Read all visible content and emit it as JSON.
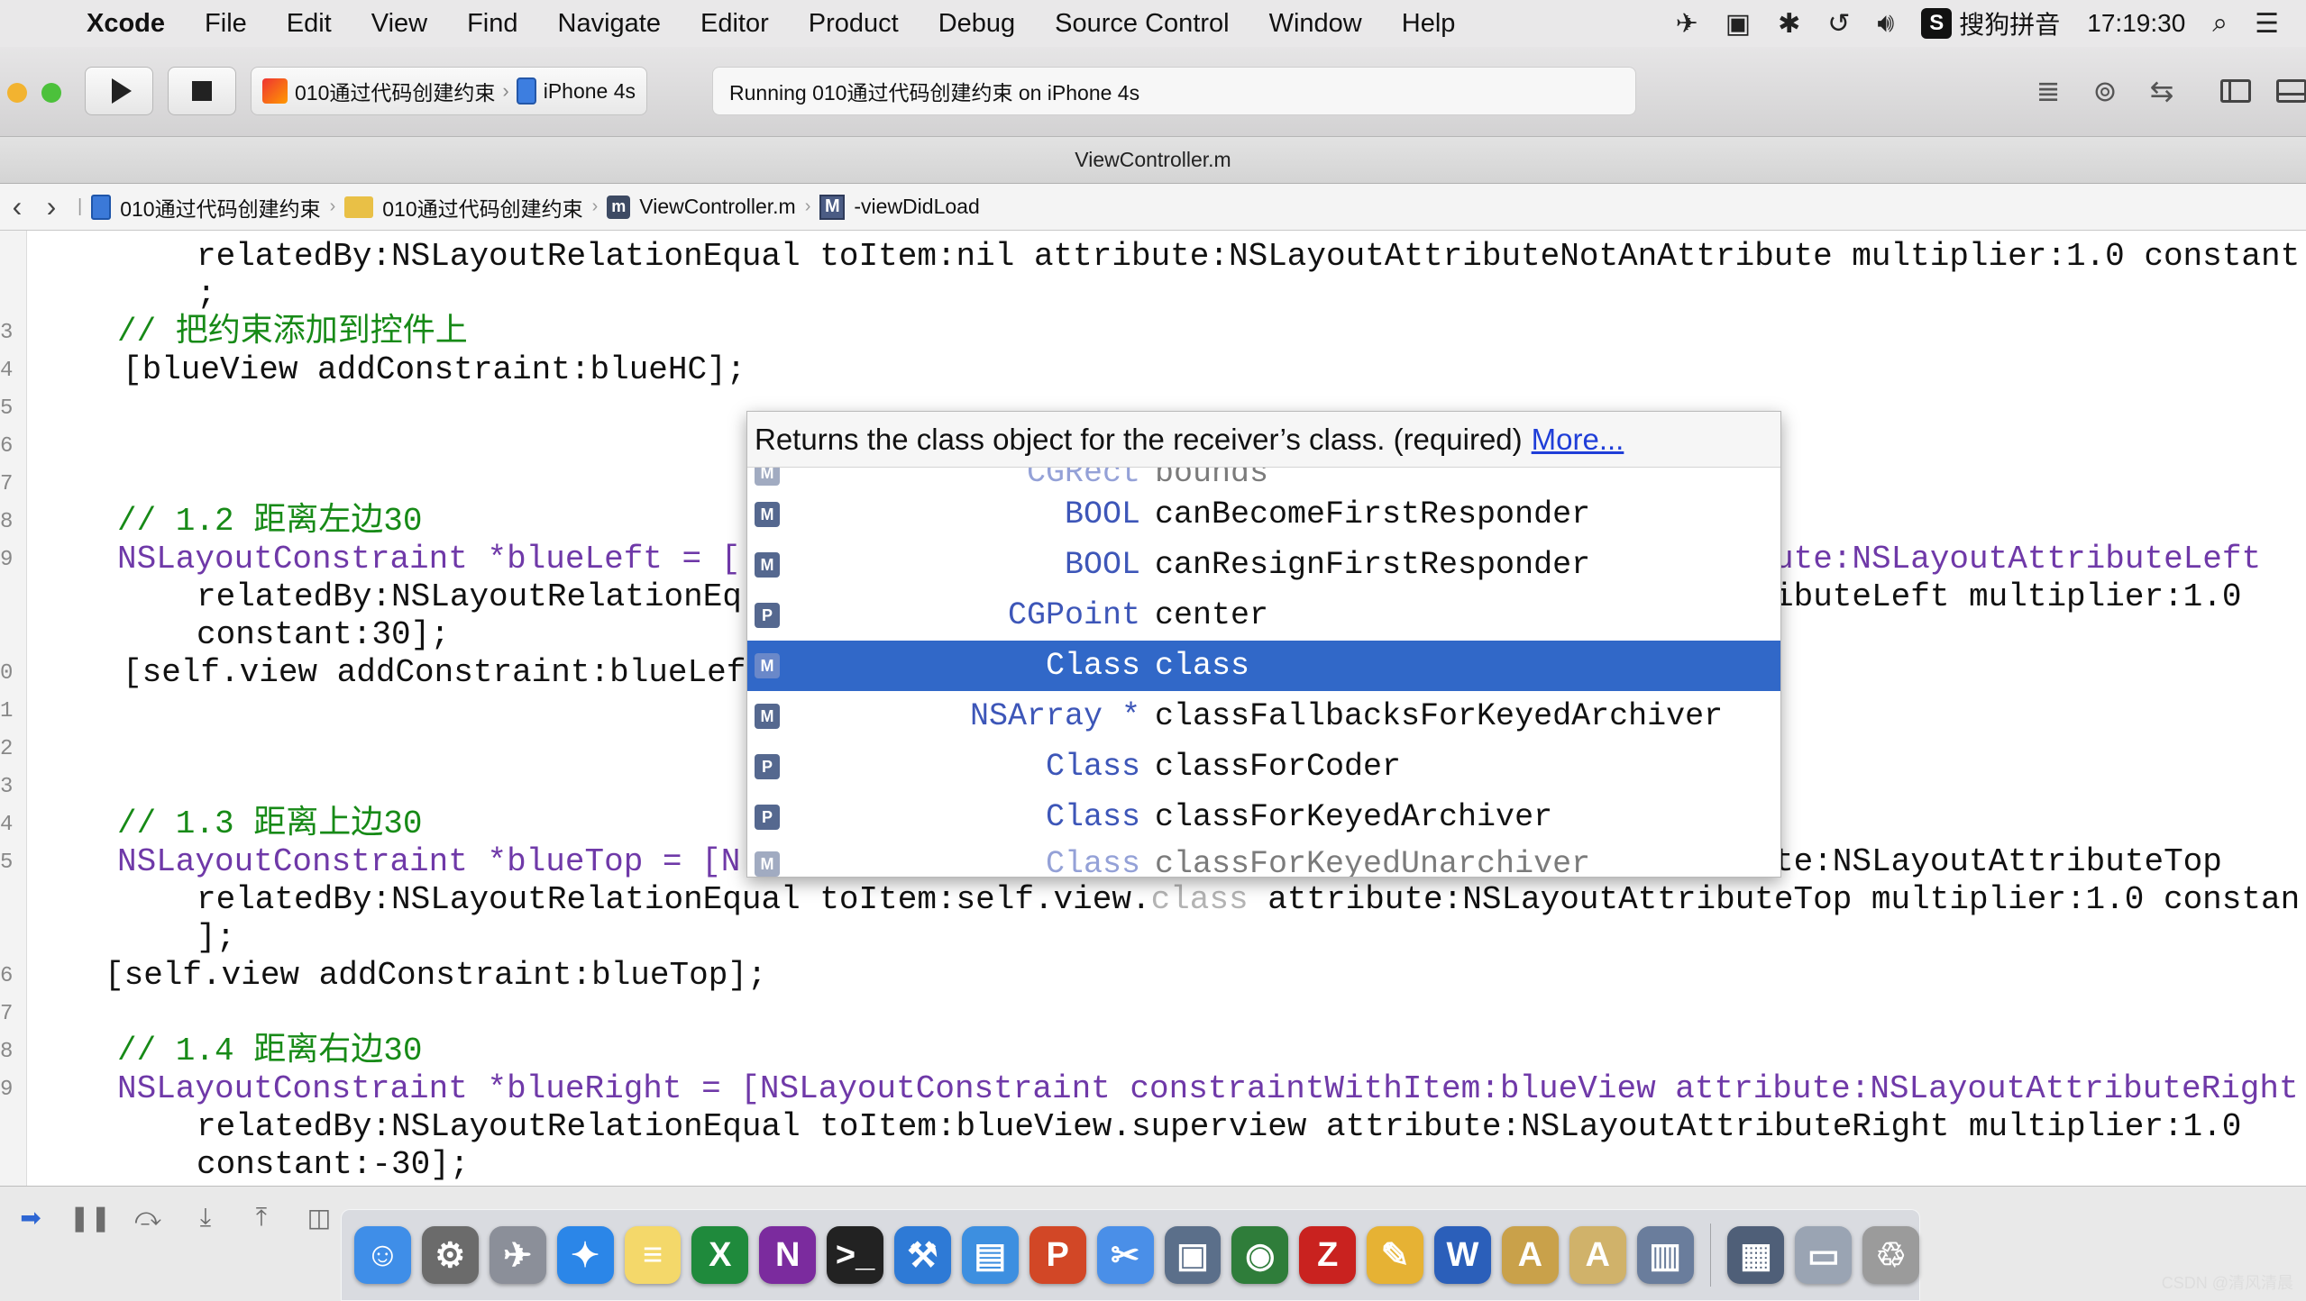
{
  "menubar": {
    "app_name": "Xcode",
    "items": [
      "File",
      "Edit",
      "View",
      "Find",
      "Navigate",
      "Editor",
      "Product",
      "Debug",
      "Source Control",
      "Window",
      "Help"
    ],
    "ime_label": "搜狗拼音",
    "clock": "17:19:30"
  },
  "toolbar": {
    "scheme": "010通过代码创建约束",
    "device": "iPhone 4s",
    "activity": "Running 010通过代码创建约束 on iPhone 4s",
    "colors": {
      "minimize": "#f2b330",
      "zoom": "#4cc13b"
    }
  },
  "tabbar": {
    "title": "ViewController.m"
  },
  "jumpbar": {
    "project": "010通过代码创建约束",
    "group": "010通过代码创建约束",
    "file": "ViewController.m",
    "file_badge": "m",
    "method_badge": "M",
    "method": "-viewDidLoad"
  },
  "gutter": [
    "3",
    "4",
    "5",
    "6",
    "7",
    "8",
    "9",
    "",
    "0",
    "1",
    "2",
    "3",
    "4",
    "5",
    "",
    "6",
    "7",
    "8",
    "9"
  ],
  "code": {
    "l01": "relatedBy:NSLayoutRelationEqual toItem:nil attribute:NSLayoutAttributeNotAnAttribute multiplier:1.0 constant",
    "l02": ";",
    "l03": "// 把约束添加到控件上",
    "l04": "[blueView addConstraint:blueHC];",
    "l05": "// 1.2 距离左边30",
    "l06a": "NSLayoutConstraint *blueLeft = [",
    "l06b": "ute:NSLayoutAttributeLeft",
    "l07a": "relatedBy:NSLayoutRelationEq",
    "l07b": "ibuteLeft multiplier:1.0",
    "l08": "constant:30];",
    "l09": "[self.view addConstraint:blueLef",
    "l10": "// 1.3 距离上边30",
    "l11a": "NSLayoutConstraint *blueTop = [N",
    "l11b": "te:NSLayoutAttributeTop",
    "l12a": "relatedBy:NSLayoutRelationEqual toItem:self.view.",
    "l12ghost": "class",
    "l12b": " attribute:NSLayoutAttributeTop multiplier:1.0 constan",
    "l13": "];",
    "l14": "[self.view addConstraint:blueTop];",
    "l15": "// 1.4 距离右边30",
    "l16": "NSLayoutConstraint *blueRight = [NSLayoutConstraint constraintWithItem:blueView attribute:NSLayoutAttributeRight",
    "l17": "relatedBy:NSLayoutRelationEqual toItem:blueView.superview attribute:NSLayoutAttributeRight multiplier:1.0",
    "l18": "constant:-30];"
  },
  "completion": {
    "description": "Returns the class object for the receiver’s class. (required)",
    "more_link": "More...",
    "items": [
      {
        "badge": "M",
        "type": "CGRect",
        "name": "bounds"
      },
      {
        "badge": "M",
        "type": "BOOL",
        "name": "canBecomeFirstResponder"
      },
      {
        "badge": "M",
        "type": "BOOL",
        "name": "canResignFirstResponder"
      },
      {
        "badge": "P",
        "type": "CGPoint",
        "name": "center"
      },
      {
        "badge": "M",
        "type": "Class",
        "name": "class"
      },
      {
        "badge": "M",
        "type": "NSArray *",
        "name": "classFallbacksForKeyedArchiver"
      },
      {
        "badge": "P",
        "type": "Class",
        "name": "classForCoder"
      },
      {
        "badge": "P",
        "type": "Class",
        "name": "classForKeyedArchiver"
      },
      {
        "badge": "M",
        "type": "Class",
        "name": "classForKeyedUnarchiver"
      }
    ],
    "selected_index": 4,
    "colors": {
      "selection": "#3168c8",
      "type": "#3d56b8"
    }
  },
  "debugbar": {
    "breakpoints_color": "#2e66d3"
  },
  "dock": {
    "apps": [
      {
        "name": "finder-app",
        "glyph": "☺",
        "color": "#3f8ee8"
      },
      {
        "name": "system-preferences-app",
        "glyph": "⚙",
        "color": "#6b6b6b"
      },
      {
        "name": "launchpad-app",
        "glyph": "✈",
        "color": "#8b8f99"
      },
      {
        "name": "safari-app",
        "glyph": "✦",
        "color": "#2b86e8"
      },
      {
        "name": "notes-app",
        "glyph": "≡",
        "color": "#f4d86a"
      },
      {
        "name": "excel-app",
        "glyph": "X",
        "color": "#1f8a3c"
      },
      {
        "name": "onenote-app",
        "glyph": "N",
        "color": "#7b2b9e"
      },
      {
        "name": "terminal-app",
        "glyph": ">_",
        "color": "#222222"
      },
      {
        "name": "xcode-app",
        "glyph": "⚒",
        "color": "#2e7ad6"
      },
      {
        "name": "folder-app",
        "glyph": "▤",
        "color": "#3d8fe0"
      },
      {
        "name": "powerpoint-app",
        "glyph": "P",
        "color": "#d24726"
      },
      {
        "name": "simulator-app",
        "glyph": "✂",
        "color": "#4a8fe8"
      },
      {
        "name": "photo-app",
        "glyph": "▣",
        "color": "#5b6f8a"
      },
      {
        "name": "network-app",
        "glyph": "◉",
        "color": "#2f7d3a"
      },
      {
        "name": "filezilla-app",
        "glyph": "Z",
        "color": "#c9221f"
      },
      {
        "name": "tools-app",
        "glyph": "✎",
        "color": "#e6b234"
      },
      {
        "name": "word-app",
        "glyph": "W",
        "color": "#2b5fba"
      },
      {
        "name": "text-app-1",
        "glyph": "A",
        "color": "#c9a14a"
      },
      {
        "name": "text-app-2",
        "glyph": "A",
        "color": "#d0b26a"
      },
      {
        "name": "preview-app",
        "glyph": "▥",
        "color": "#6a7d9c"
      },
      {
        "name": "screen-app",
        "glyph": "▦",
        "color": "#4f5f78"
      },
      {
        "name": "window-app",
        "glyph": "▭",
        "color": "#9aa4b3"
      },
      {
        "name": "trash-app",
        "glyph": "♲",
        "color": "#9b9b9b"
      }
    ]
  },
  "watermark": "CSDN @清风清晨"
}
